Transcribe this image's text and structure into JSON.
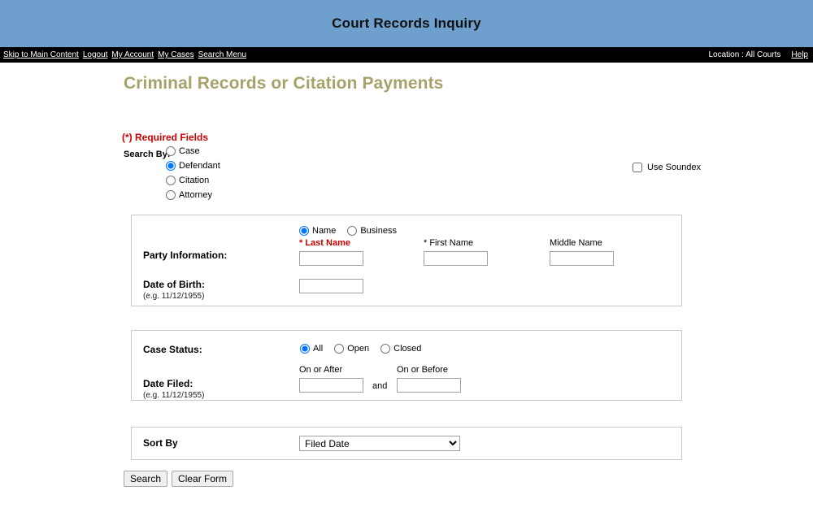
{
  "header": {
    "title": "Court Records Inquiry",
    "background_color": "#6f9fcd"
  },
  "navbar": {
    "links": [
      {
        "label": "Skip to Main Content",
        "name": "skip-to-main-content-link"
      },
      {
        "label": "Logout",
        "name": "logout-link"
      },
      {
        "label": "My Account",
        "name": "my-account-link"
      },
      {
        "label": "My Cases",
        "name": "my-cases-link"
      },
      {
        "label": "Search Menu",
        "name": "search-menu-link"
      }
    ],
    "location_text": "Location : All Courts",
    "help_label": "Help",
    "background_color": "#000000"
  },
  "page": {
    "heading": "Criminal Records or Citation Payments",
    "heading_color": "#a7a16a",
    "required_note": "(*) Required Fields",
    "required_note_color": "#cc0000"
  },
  "search_by": {
    "label": "Search By:",
    "options": [
      {
        "label": "Case",
        "selected": false
      },
      {
        "label": "Defendant",
        "selected": true
      },
      {
        "label": "Citation",
        "selected": false
      },
      {
        "label": "Attorney",
        "selected": false
      }
    ],
    "selected": "Defendant"
  },
  "soundex": {
    "label": "Use Soundex",
    "checked": false
  },
  "party_information": {
    "label": "Party Information:",
    "type_options": [
      {
        "label": "Name",
        "selected": true
      },
      {
        "label": "Business",
        "selected": false
      }
    ],
    "type_selected": "Name",
    "last_name": {
      "label": "* Last Name",
      "value": "",
      "required": true
    },
    "first_name": {
      "label": "* First Name",
      "value": "",
      "required": true
    },
    "middle_name": {
      "label": "Middle Name",
      "value": "",
      "required": false
    },
    "date_of_birth": {
      "label": "Date of Birth:",
      "hint": "(e.g. 11/12/1955)",
      "value": ""
    }
  },
  "case_status": {
    "label": "Case Status:",
    "options": [
      {
        "label": "All",
        "selected": true
      },
      {
        "label": "Open",
        "selected": false
      },
      {
        "label": "Closed",
        "selected": false
      }
    ],
    "selected": "All"
  },
  "date_filed": {
    "label": "Date Filed:",
    "hint": "(e.g. 11/12/1955)",
    "on_or_after_label": "On or After",
    "on_or_after_value": "",
    "conjunction": "and",
    "on_or_before_label": "On or Before",
    "on_or_before_value": ""
  },
  "sort_by": {
    "label": "Sort By",
    "selected": "Filed Date",
    "options": [
      "Filed Date"
    ]
  },
  "buttons": {
    "search_label": "Search",
    "clear_label": "Clear Form"
  }
}
